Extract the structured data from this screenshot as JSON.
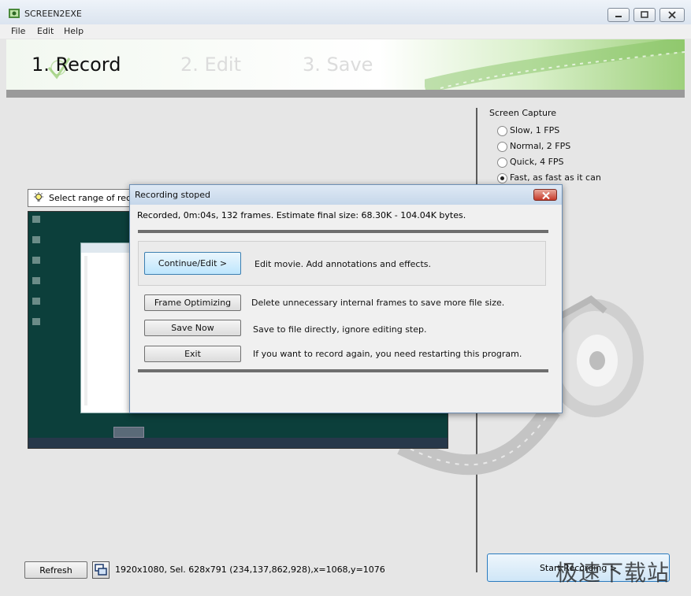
{
  "window": {
    "title": "SCREEN2EXE",
    "icons": {
      "app": "film-reel-app-icon",
      "minimize": "minimize-icon",
      "maximize": "maximize-icon",
      "close": "close-icon"
    }
  },
  "menu": [
    "File",
    "Edit",
    "Help"
  ],
  "steps": [
    {
      "label": "1. Record",
      "active": true
    },
    {
      "label": "2. Edit",
      "active": false
    },
    {
      "label": "3. Save",
      "active": false
    }
  ],
  "capture": {
    "title": "Screen Capture",
    "options": [
      {
        "label": "Slow, 1 FPS",
        "selected": false
      },
      {
        "label": "Normal, 2 FPS",
        "selected": false
      },
      {
        "label": "Quick, 4 FPS",
        "selected": false
      },
      {
        "label": "Fast, as fast as it can",
        "selected": true
      }
    ]
  },
  "preview": {
    "range_label": "Select range of recording"
  },
  "bottom": {
    "refresh": "Refresh",
    "status": "1920x1080, Sel. 628x791 (234,137,862,928),x=1068,y=1076",
    "start": "Start Recording >"
  },
  "watermark": "极速下载站",
  "dialog": {
    "title": "Recording stoped",
    "summary": "Recorded, 0m:04s, 132 frames. Estimate final size: 68.30K - 104.04K bytes.",
    "actions": [
      {
        "button": "Continue/Edit >",
        "desc": "Edit movie. Add annotations and effects."
      },
      {
        "button": "Frame Optimizing",
        "desc": "Delete unnecessary internal frames to save more file size."
      },
      {
        "button": "Save Now",
        "desc": "Save to file directly, ignore editing step."
      },
      {
        "button": "Exit",
        "desc": "If you want to record again, you need restarting this program."
      }
    ]
  },
  "colors": {
    "accent_green": "#9ed07c",
    "dialog_close_red": "#c5392a",
    "preview_bg": "#0c3f3b"
  }
}
